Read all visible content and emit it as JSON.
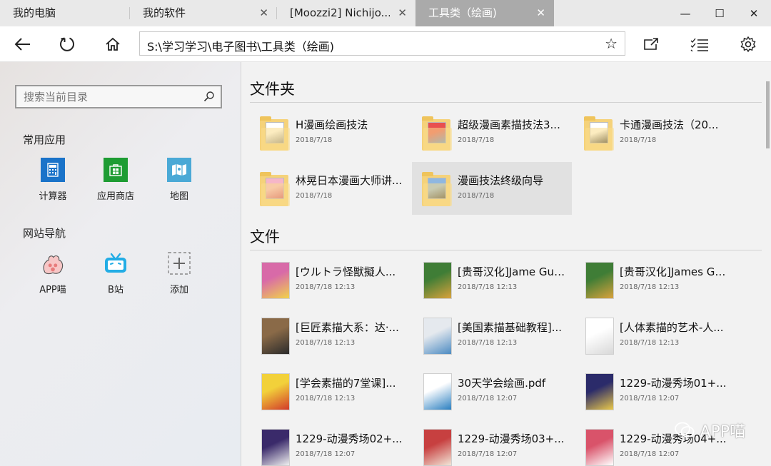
{
  "tabs": [
    {
      "label": "我的电脑",
      "active": false,
      "closable": false
    },
    {
      "label": "我的软件",
      "active": false,
      "closable": true
    },
    {
      "label": "[Moozzi2] Nichijo...",
      "active": false,
      "closable": true
    },
    {
      "label": "工具类（绘画)",
      "active": true,
      "closable": true
    }
  ],
  "window_controls": {
    "minimize": "—",
    "maximize": "☐",
    "close": "✕",
    "tab_close": "✕"
  },
  "toolbar": {
    "address": "S:\\学习学习\\电子图书\\工具类（绘画)",
    "star": "☆",
    "icons": [
      "back-arrow-icon",
      "refresh-icon",
      "home-icon",
      "open-external-icon",
      "list-check-icon",
      "gear-icon"
    ]
  },
  "sidebar": {
    "search_placeholder": "搜索当前目录",
    "apps_title": "常用应用",
    "apps": [
      {
        "label": "计算器",
        "icon": "calculator-icon",
        "color": "#1a73c9"
      },
      {
        "label": "应用商店",
        "icon": "store-icon",
        "color": "#1e9c33"
      },
      {
        "label": "地图",
        "icon": "map-icon",
        "color": "#4aa9d6"
      }
    ],
    "sites_title": "网站导航",
    "sites": [
      {
        "label": "APP喵",
        "icon": "cat-paw-icon"
      },
      {
        "label": "B站",
        "icon": "bilibili-tv-icon",
        "color": "#23ade5"
      },
      {
        "label": "添加",
        "icon": "add-icon"
      }
    ]
  },
  "main": {
    "folders_heading": "文件夹",
    "folders": [
      {
        "name": "H漫画绘画技法",
        "date": "2018/7/18",
        "thumb": [
          "#ffffff",
          "#888888"
        ]
      },
      {
        "name": "超级漫画素描技法3...",
        "date": "2018/7/18",
        "thumb": [
          "#e8504f",
          "#5b8fd0"
        ]
      },
      {
        "name": "卡通漫画技法（20...",
        "date": "2018/7/18",
        "thumb": [
          "#ffffff",
          "#333333"
        ]
      },
      {
        "name": "林晃日本漫画大师讲...",
        "date": "2018/7/18",
        "thumb": [
          "#f6b6c8",
          "#d04a6a"
        ]
      },
      {
        "name": "漫画技法终级向导",
        "date": "2018/7/18",
        "thumb": [
          "#8fb7e0",
          "#3a3a3a"
        ],
        "selected": true
      }
    ],
    "files_heading": "文件",
    "files": [
      {
        "name": "[ウルトラ怪獣擬人...",
        "date": "2018/7/18 12:13",
        "thumb": [
          "#d86aa8",
          "#f1d34a"
        ]
      },
      {
        "name": "[贵哥汉化]Jame Gur...",
        "date": "2018/7/18 12:13",
        "thumb": [
          "#3f7d36",
          "#d9a23c"
        ]
      },
      {
        "name": "[贵哥汉化]James Gu...",
        "date": "2018/7/18 12:13",
        "thumb": [
          "#3f7d36",
          "#d9a23c"
        ]
      },
      {
        "name": "[巨匠素描大系：达·...",
        "date": "2018/7/18 12:13",
        "thumb": [
          "#8a6a48",
          "#2b2b2b"
        ]
      },
      {
        "name": "[美国素描基础教程]...",
        "date": "2018/7/18 12:13",
        "thumb": [
          "#e5e9ee",
          "#4c8bc2"
        ]
      },
      {
        "name": "[人体素描的艺术-人...",
        "date": "2018/7/18 12:13",
        "thumb": [
          "#ffffff",
          "#d8d8d8"
        ]
      },
      {
        "name": "[学会素描的7堂课]...",
        "date": "2018/7/18 12:13",
        "thumb": [
          "#f2d13a",
          "#d23a2a"
        ]
      },
      {
        "name": "30天学会绘画.pdf",
        "date": "2018/7/18 12:07",
        "thumb": [
          "#ffffff",
          "#2a7fc0"
        ]
      },
      {
        "name": "1229-动漫秀场01+...",
        "date": "2018/7/18 12:07",
        "thumb": [
          "#2b2b6a",
          "#e9c84a"
        ]
      },
      {
        "name": "1229-动漫秀场02+...",
        "date": "2018/7/18 12:07",
        "thumb": [
          "#3a2a6a",
          "#f0f0f0"
        ]
      },
      {
        "name": "1229-动漫秀场03+...",
        "date": "2018/7/18 12:07",
        "thumb": [
          "#c74040",
          "#f2e6d8"
        ]
      },
      {
        "name": "1229-动漫秀场04+...",
        "date": "2018/7/18 12:07",
        "thumb": [
          "#d9536a",
          "#ffffff"
        ]
      }
    ]
  },
  "watermark": "APP喵"
}
